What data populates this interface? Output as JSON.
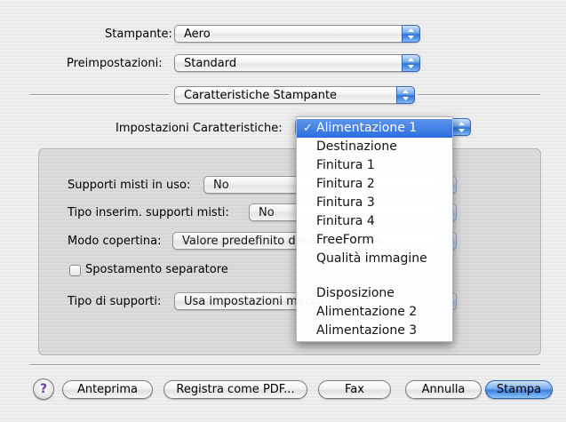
{
  "printer": {
    "label": "Stampante:",
    "value": "Aero"
  },
  "presets": {
    "label": "Preimpostazioni:",
    "value": "Standard"
  },
  "panel": {
    "value": "Caratteristiche Stampante"
  },
  "feature_settings": {
    "label": "Impostazioni Caratteristiche:",
    "value": "Alimentazione 1"
  },
  "group": {
    "mixed_media": {
      "label": "Supporti misti in uso:",
      "value": "No"
    },
    "insert_type": {
      "label": "Tipo inserim. supporti misti:",
      "value": "No"
    },
    "cover_mode": {
      "label": "Modo copertina:",
      "value": "Valore predefinito della stampante"
    },
    "separator_shift": {
      "label": "Spostamento separatore",
      "checked": false
    },
    "media_type": {
      "label": "Tipo di supporti:",
      "value": "Usa impostazioni macchina"
    }
  },
  "menu": {
    "items": [
      "Alimentazione 1",
      "Destinazione",
      "Finitura 1",
      "Finitura 2",
      "Finitura 3",
      "Finitura 4",
      "FreeForm",
      "Qualità immagine",
      "Disposizione",
      "Alimentazione 2",
      "Alimentazione 3"
    ],
    "selected_index": 0,
    "check_glyph": "✓"
  },
  "buttons": {
    "help": "?",
    "preview": "Anteprima",
    "save_pdf": "Registra come PDF...",
    "fax": "Fax",
    "cancel": "Annulla",
    "print": "Stampa"
  },
  "colors": {
    "accent": "#2b6ee0",
    "help_icon": "#6d3aa8"
  }
}
